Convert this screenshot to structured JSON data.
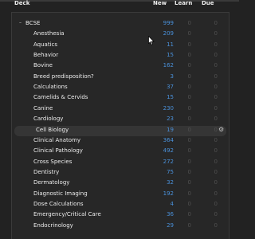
{
  "header": {
    "deck": "Deck",
    "new": "New",
    "learn": "Learn",
    "due": "Due"
  },
  "decks": [
    {
      "name": "BCSE",
      "new": "999",
      "learn": "0",
      "due": "0",
      "level": 0,
      "expanded": true
    },
    {
      "name": "Anesthesia",
      "new": "209",
      "learn": "0",
      "due": "0",
      "level": 1
    },
    {
      "name": "Aquatics",
      "new": "11",
      "learn": "0",
      "due": "0",
      "level": 1
    },
    {
      "name": "Behavior",
      "new": "15",
      "learn": "0",
      "due": "0",
      "level": 1
    },
    {
      "name": "Bovine",
      "new": "162",
      "learn": "0",
      "due": "0",
      "level": 1
    },
    {
      "name": "Breed predisposition?",
      "new": "3",
      "learn": "0",
      "due": "0",
      "level": 1
    },
    {
      "name": "Calculations",
      "new": "37",
      "learn": "0",
      "due": "0",
      "level": 1
    },
    {
      "name": "Camelids & Cervids",
      "new": "15",
      "learn": "0",
      "due": "0",
      "level": 1
    },
    {
      "name": "Canine",
      "new": "230",
      "learn": "0",
      "due": "0",
      "level": 1
    },
    {
      "name": "Cardiology",
      "new": "23",
      "learn": "0",
      "due": "0",
      "level": 1
    },
    {
      "name": "Cell Biology",
      "new": "19",
      "learn": "0",
      "due": "0",
      "level": 1,
      "selected": true
    },
    {
      "name": "Clinical Anatomy",
      "new": "364",
      "learn": "0",
      "due": "0",
      "level": 1
    },
    {
      "name": "Clinical Pathology",
      "new": "492",
      "learn": "0",
      "due": "0",
      "level": 1
    },
    {
      "name": "Cross Species",
      "new": "272",
      "learn": "0",
      "due": "0",
      "level": 1
    },
    {
      "name": "Dentistry",
      "new": "75",
      "learn": "0",
      "due": "0",
      "level": 1
    },
    {
      "name": "Dermatology",
      "new": "32",
      "learn": "0",
      "due": "0",
      "level": 1
    },
    {
      "name": "Diagnostic Imaging",
      "new": "192",
      "learn": "0",
      "due": "0",
      "level": 1
    },
    {
      "name": "Dose Calculations",
      "new": "4",
      "learn": "0",
      "due": "0",
      "level": 1
    },
    {
      "name": "Emergency/Critical Care",
      "new": "36",
      "learn": "0",
      "due": "0",
      "level": 1
    },
    {
      "name": "Endocrinology",
      "new": "29",
      "learn": "0",
      "due": "0",
      "level": 1
    }
  ],
  "icons": {
    "caret": "caret-down-icon",
    "gear": "gear-icon",
    "cursor": "mouse-pointer-icon"
  },
  "colors": {
    "background": "#222222",
    "new_count": "#4a90d9",
    "zero_count": "#505050",
    "selected_row": "#353535"
  }
}
